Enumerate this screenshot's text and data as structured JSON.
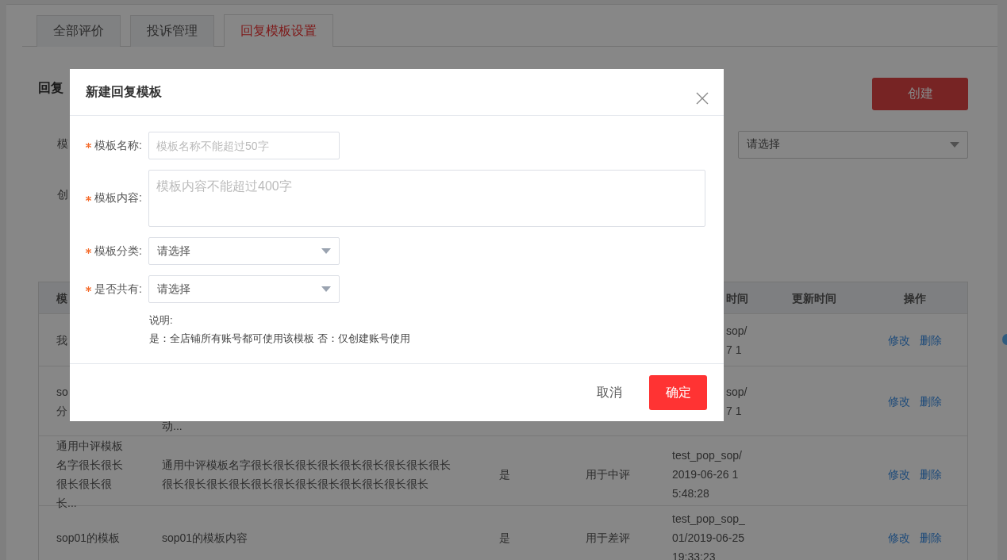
{
  "tabs": [
    {
      "label": "全部评价",
      "selected": false
    },
    {
      "label": "投诉管理",
      "selected": false
    },
    {
      "label": "回复模板设置",
      "selected": true
    }
  ],
  "page_title": "回复",
  "create_button": "创建",
  "filters": [
    {
      "label": "模"
    },
    {
      "label": "创"
    }
  ],
  "filter_select": {
    "placeholder": "请选择"
  },
  "table": {
    "header": {
      "column_1": "模",
      "column_5": "时间",
      "column_6": "更新时间",
      "column_7": "操作"
    },
    "rows": [
      {
        "column_1": [
          "我"
        ],
        "column_5": [
          "sop/",
          "7 1"
        ],
        "actions": [
          "修改",
          "删除"
        ]
      },
      {
        "column_1": [
          "so",
          "分"
        ],
        "column_2": [
          "动..."
        ],
        "column_5": [
          "sop/",
          "7 1"
        ],
        "actions": [
          "修改",
          "删除"
        ]
      },
      {
        "column_1": [
          "通用中评模板",
          "名字很长很长",
          "很长很长很",
          "长..."
        ],
        "column_2": [
          "通用中评模板名字很长很长很长很长很长很长很长很长很长",
          "很长很长很长很长很长很长很长很长很长很长很长很长"
        ],
        "column_3": "是",
        "column_4": "用于中评",
        "column_5": [
          "test_pop_sop/",
          "2019-06-26 1",
          "5:48:28"
        ],
        "actions": [
          "修改",
          "删除"
        ]
      },
      {
        "column_1": [
          "sop01的模板"
        ],
        "column_2": [
          "sop01的模板内容"
        ],
        "column_3": "是",
        "column_4": "用于差评",
        "column_5": [
          "test_pop_sop_",
          "01/2019-06-25",
          "19:33:23"
        ],
        "actions": [
          "修改",
          "删除"
        ]
      }
    ]
  },
  "dialog": {
    "title": "新建回复模板",
    "fields": [
      {
        "kind": "input",
        "label": "模板名称:",
        "required": true,
        "placeholder": "模板名称不能超过50字"
      },
      {
        "kind": "textarea",
        "label": "模板内容:",
        "required": true,
        "placeholder": "模板内容不能超过400字"
      },
      {
        "kind": "select",
        "label": "模板分类:",
        "required": true,
        "placeholder": "请选择"
      },
      {
        "kind": "select",
        "label": "是否共有:",
        "required": true,
        "placeholder": "请选择"
      }
    ],
    "note": [
      "说明:",
      "是：全店铺所有账号都可使用该模板 否：仅创建账号使用"
    ],
    "cancel_button": "取消",
    "confirm_button": "确定"
  }
}
